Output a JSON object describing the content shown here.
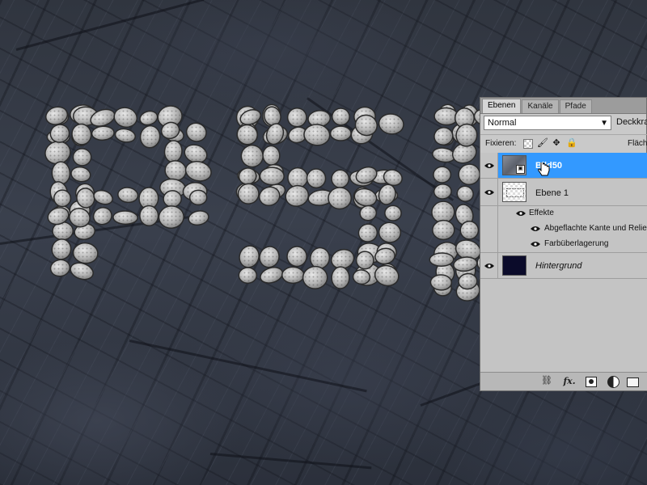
{
  "panel": {
    "tabs": [
      {
        "label": "Ebenen",
        "active": true
      },
      {
        "label": "Kanäle",
        "active": false
      },
      {
        "label": "Pfade",
        "active": false
      }
    ],
    "blend_mode": "Normal",
    "opacity_label": "Deckkra",
    "lock_label": "Fixieren:",
    "fill_label": "Fläch",
    "lock_icons": [
      "transparency-lock-icon",
      "brush-lock-icon",
      "move-lock-icon",
      "padlock-icon"
    ],
    "layers": [
      {
        "name": "Bild50",
        "selected": true,
        "visible": true
      },
      {
        "name": "Ebene 1",
        "selected": false,
        "visible": true,
        "effects_label": "Effekte",
        "effects": [
          "Abgeflachte Kante und Relief",
          "Farbüberlagerung"
        ]
      },
      {
        "name": "Hintergrund",
        "selected": false,
        "visible": true,
        "italic": true
      }
    ],
    "bottom_icons": [
      "link-icon",
      "fx-icon",
      "mask-icon",
      "adjustment-icon",
      "folder-icon"
    ],
    "bottom_fx": "fx."
  },
  "colors": {
    "selection": "#3399ff",
    "panel_bg": "#c9c9c9",
    "stone": "#c8c8c8",
    "rock_bg": "#30353f"
  }
}
